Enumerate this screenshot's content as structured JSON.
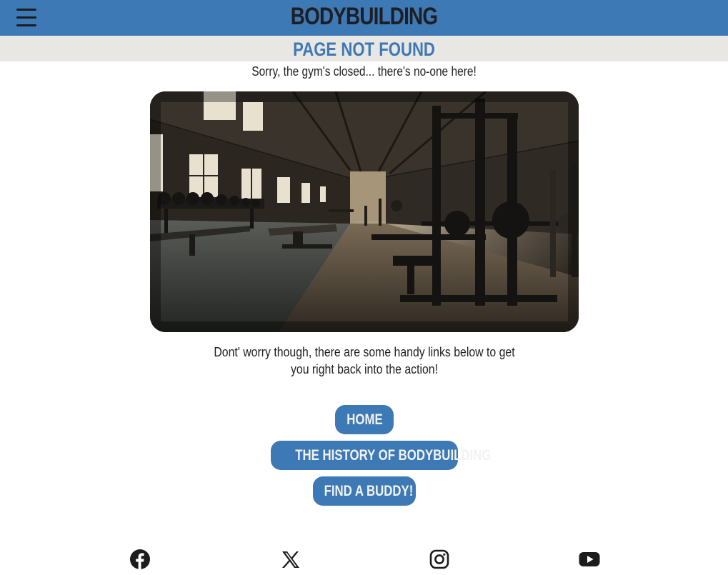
{
  "header": {
    "menu_icon": "hamburger-menu-icon",
    "brand": "BODYBUILDING"
  },
  "banner": {
    "title": "PAGE NOT FOUND"
  },
  "main": {
    "subtitle": "Sorry, the gym's closed... there's no-one here!",
    "image_description_icon": "empty-gym-image",
    "message": "Dont' worry though, there are some handy links below to get you right back into the action!",
    "links": [
      {
        "label": "HOME"
      },
      {
        "label": "THE HISTORY OF BODYBUILDING"
      },
      {
        "label": "FIND A BUDDY!"
      }
    ]
  },
  "footer": {
    "social": [
      {
        "icon": "facebook-icon"
      },
      {
        "icon": "x-twitter-icon"
      },
      {
        "icon": "instagram-icon"
      },
      {
        "icon": "youtube-icon"
      }
    ]
  },
  "colors": {
    "primary": "#3d79b4",
    "banner_bg": "#e8e7e3",
    "dark_text": "#1e1e24"
  }
}
